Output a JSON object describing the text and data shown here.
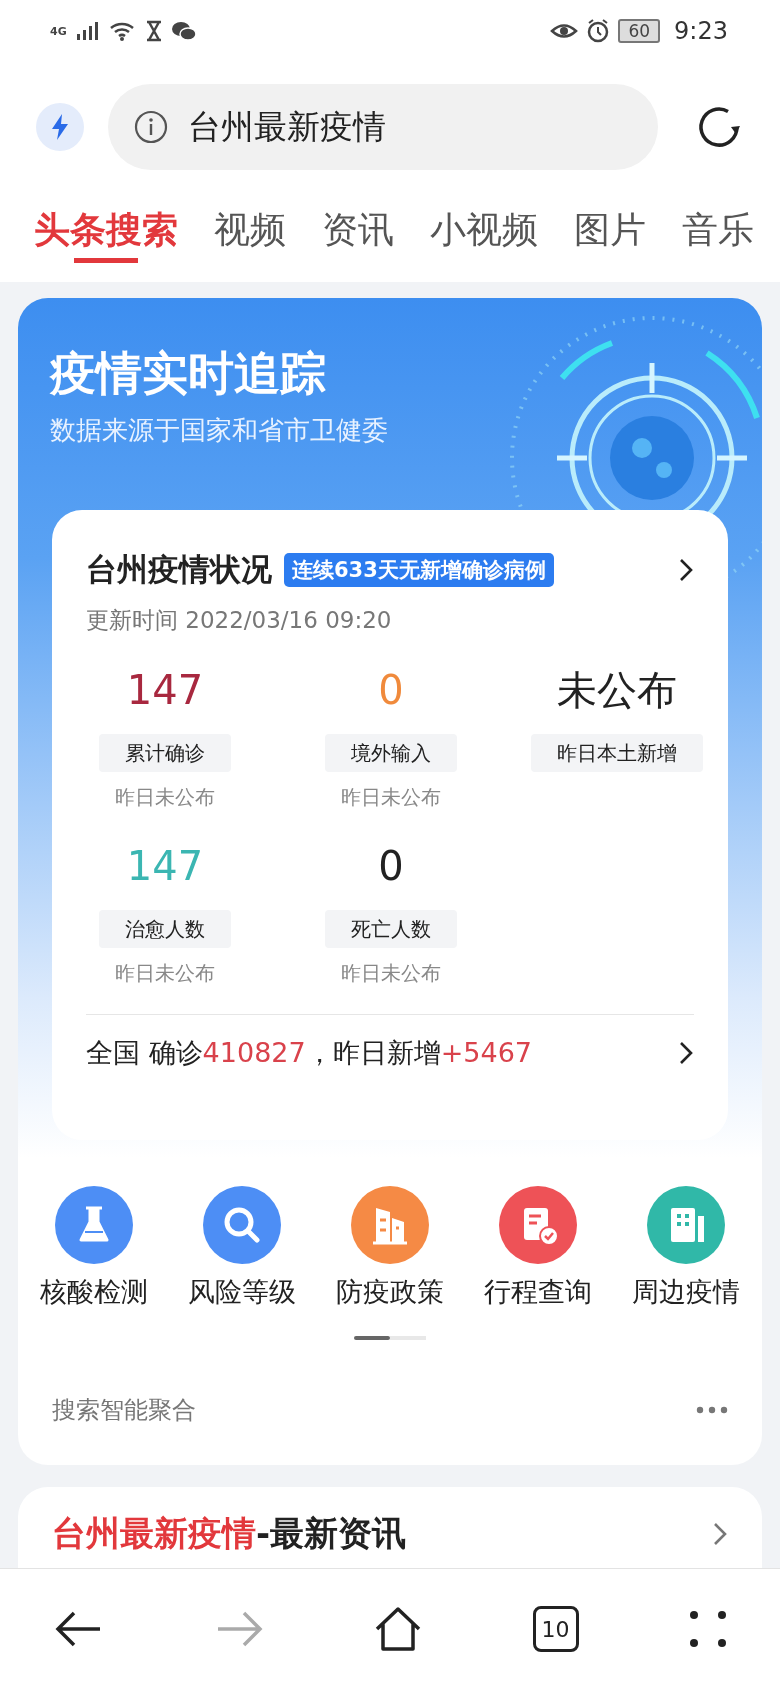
{
  "status_bar": {
    "network": "4G",
    "battery": "60",
    "time": "9:23"
  },
  "address_bar": {
    "query": "台州最新疫情"
  },
  "tabs": [
    {
      "label": "头条搜索",
      "selected": true
    },
    {
      "label": "视频",
      "selected": false
    },
    {
      "label": "资讯",
      "selected": false
    },
    {
      "label": "小视频",
      "selected": false
    },
    {
      "label": "图片",
      "selected": false
    },
    {
      "label": "音乐",
      "selected": false
    }
  ],
  "tracker": {
    "title": "疫情实时追踪",
    "subtitle": "数据来源于国家和省市卫健委",
    "local": {
      "title": "台州疫情状况",
      "badge": "连续633天无新增确诊病例",
      "updated": "更新时间 2022/03/16 09:20",
      "stats": [
        {
          "value": "147",
          "label": "累计确诊",
          "note": "昨日未公布",
          "color": "#a8283f"
        },
        {
          "value": "0",
          "label": "境外输入",
          "note": "昨日未公布",
          "color": "#f08a3c"
        },
        {
          "value": "未公布",
          "label": "昨日本土新增",
          "color": "#222222"
        },
        {
          "value": "147",
          "label": "治愈人数",
          "note": "昨日未公布",
          "color": "#3bb6b2"
        },
        {
          "value": "0",
          "label": "死亡人数",
          "note": "昨日未公布",
          "color": "#222222"
        }
      ],
      "national": {
        "label": "全国 确诊",
        "confirmed": "410827",
        "middle": "，昨日新增",
        "added": "+5467"
      }
    },
    "services": [
      {
        "kind": "flask",
        "label": "核酸检测"
      },
      {
        "kind": "search",
        "label": "风险等级"
      },
      {
        "kind": "building",
        "label": "防疫政策"
      },
      {
        "kind": "form",
        "label": "行程查询"
      },
      {
        "kind": "city",
        "label": "周边疫情"
      }
    ],
    "pages": [
      {
        "selected": true
      },
      {
        "selected": false
      }
    ],
    "footer": "搜索智能聚合"
  },
  "news": {
    "highlight": "台州最新疫情",
    "rest": "-最新资讯"
  },
  "bottom_nav": [
    {
      "kind": "back",
      "disabled": false
    },
    {
      "kind": "forward",
      "disabled": true
    },
    {
      "kind": "home",
      "disabled": false
    },
    {
      "kind": "tabs",
      "count": "10",
      "disabled": false
    },
    {
      "kind": "menu",
      "disabled": false
    }
  ]
}
